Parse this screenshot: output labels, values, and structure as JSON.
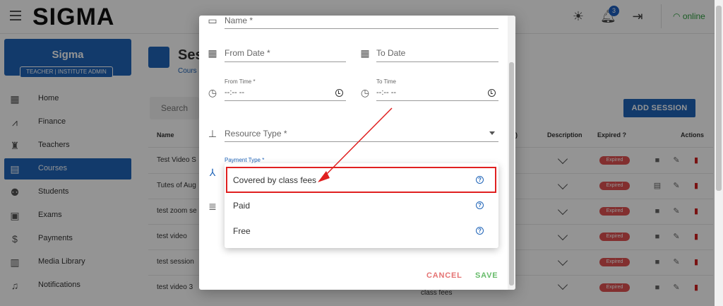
{
  "header": {
    "brand": "SIGMA",
    "notification_count": "3",
    "status": "online"
  },
  "sidebar": {
    "org_name": "Sigma",
    "org_role": "TEACHER | INSTITUTE ADMIN",
    "items": [
      {
        "label": "Home",
        "icon": "dashboard-icon"
      },
      {
        "label": "Finance",
        "icon": "chart-icon"
      },
      {
        "label": "Teachers",
        "icon": "teacher-icon"
      },
      {
        "label": "Courses",
        "icon": "courses-icon"
      },
      {
        "label": "Students",
        "icon": "students-icon"
      },
      {
        "label": "Exams",
        "icon": "exam-icon"
      },
      {
        "label": "Payments",
        "icon": "dollar-icon"
      },
      {
        "label": "Media Library",
        "icon": "media-icon"
      },
      {
        "label": "Notifications",
        "icon": "bell-icon"
      }
    ]
  },
  "main": {
    "title": "Ses",
    "breadcrumb": "Cours",
    "search_placeholder": "Search",
    "add_button": "ADD SESSION",
    "columns": {
      "name": "Name",
      "hidden": ")",
      "description": "Description",
      "expired": "Expired ?",
      "actions": "Actions"
    },
    "rows": [
      {
        "name": "Test Video S",
        "expired": "Expired",
        "action_icon": "camera-icon"
      },
      {
        "name": "Tutes of Aug",
        "expired": "Expired",
        "action_icon": "document-icon"
      },
      {
        "name": "test zoom se",
        "expired": "Expired",
        "action_icon": "video-icon"
      },
      {
        "name": "test video",
        "expired": "Expired",
        "action_icon": "camera-icon"
      },
      {
        "name": "test session",
        "expired": "Expired",
        "action_icon": "camera-icon"
      },
      {
        "name": "test video 3",
        "expired": "Expired",
        "action_icon": "camera-icon"
      }
    ],
    "partial_text": "class fees"
  },
  "dialog": {
    "name_label": "Name *",
    "from_date_label": "From Date *",
    "to_date_label": "To Date",
    "from_time_label": "From Time *",
    "to_time_label": "To Time",
    "time_placeholder": "--:-- --",
    "resource_type_label": "Resource Type *",
    "payment_type_label": "Payment Type *",
    "cancel": "CANCEL",
    "save": "SAVE"
  },
  "payment_menu": {
    "options": [
      "Covered by class fees",
      "Paid",
      "Free"
    ],
    "highlighted": "Covered by class fees"
  },
  "colors": {
    "primary": "#1f64b8",
    "expired_badge": "#e05252",
    "annotation": "#e02020",
    "online": "#2e9e3e"
  }
}
